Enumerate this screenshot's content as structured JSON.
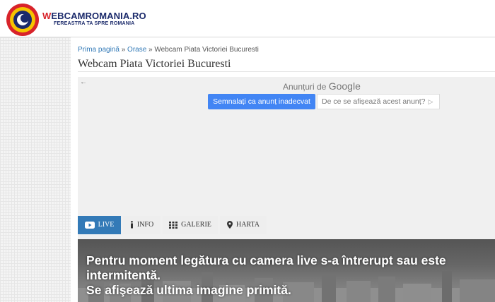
{
  "header": {
    "logo_letter": "W",
    "logo_rest": "EBCAMROMANIA.RO",
    "tagline": "FEREASTRA TA SPRE ROMANIA"
  },
  "breadcrumb": {
    "home": "Prima pagină",
    "sep1": " » ",
    "section": "Orase",
    "sep2": " » ",
    "current": "Webcam Piata Victoriei Bucuresti"
  },
  "page_title": "Webcam Piata Victoriei Bucuresti",
  "ad": {
    "label": "Anunțuri de ",
    "provider": "Google",
    "report_button": "Semnalați ca anunț inadecvat",
    "why_button": "De ce se afișează acest anunț?"
  },
  "tabs": [
    {
      "label": "LIVE",
      "icon": "youtube-play-icon"
    },
    {
      "label": "INFO",
      "icon": "info-icon"
    },
    {
      "label": "GALERIE",
      "icon": "grid-icon"
    },
    {
      "label": "HARTA",
      "icon": "map-marker-icon"
    }
  ],
  "live": {
    "message_line1": "Pentru moment legătura cu camera live s-a întrerupt sau este intermitentă.",
    "message_line2": "Se afişează ultima imagine primită."
  },
  "colors": {
    "accent": "#337ab7",
    "google_blue": "#4285f4",
    "logo_red": "#d8232a",
    "logo_navy": "#1b2a6b"
  }
}
